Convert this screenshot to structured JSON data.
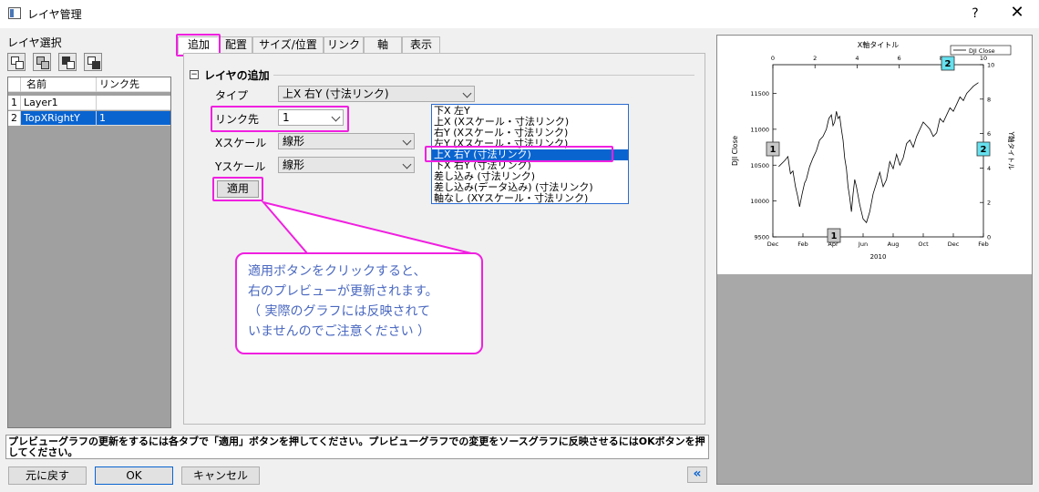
{
  "window": {
    "title": "レイヤ管理",
    "help": "?",
    "close": "✕"
  },
  "left_panel": {
    "label": "レイヤ選択",
    "columns": [
      "名前",
      "リンク先"
    ],
    "rows": [
      {
        "num": "1",
        "name": "Layer1",
        "link": ""
      },
      {
        "num": "2",
        "name": "TopXRightY",
        "link": "1"
      }
    ]
  },
  "tabs": [
    "追加",
    "配置",
    "サイズ/位置",
    "リンク",
    "軸",
    "表示"
  ],
  "section": {
    "toggle": "−",
    "title": "レイヤの追加"
  },
  "form": {
    "type_label": "タイプ",
    "type_value": "上X 右Y (寸法リンク)",
    "link_label": "リンク先",
    "link_value": "1",
    "xscale_label": "Xスケール",
    "xscale_value": "線形",
    "yscale_label": "Yスケール",
    "yscale_value": "線形",
    "apply": "適用"
  },
  "type_options": [
    "下X 左Y",
    "上X (Xスケール・寸法リンク)",
    "右Y (Xスケール・寸法リンク)",
    "左Y (Xスケール・寸法リンク)",
    "上X 右Y (寸法リンク)",
    "下X 右Y (寸法リンク)",
    "差し込み (寸法リンク)",
    "差し込み(データ込み) (寸法リンク)",
    "軸なし (XYスケール・寸法リンク)"
  ],
  "selected_option_index": 4,
  "callout": {
    "lines": [
      "適用ボタンをクリックすると、",
      "右のプレビューが更新されます。",
      "（ 実際のグラフには反映されて",
      "いませんのでご注意ください ）"
    ]
  },
  "status": "プレビューグラフの更新をするには各タブで「適用」ボタンを押してください。プレビューグラフでの変更をソースグラフに反映させるにはOKボタンを押してください。",
  "buttons": {
    "revert": "元に戻す",
    "ok": "OK",
    "cancel": "キャンセル",
    "collapse": "«"
  },
  "chart_data": {
    "type": "line",
    "top_xlabel": "X軸タイトル",
    "top_xticks": [
      "0",
      "2",
      "4",
      "6",
      "8",
      "10"
    ],
    "bottom_xticks": [
      "Dec",
      "Feb",
      "Apr",
      "Jun",
      "Aug",
      "Oct",
      "Dec",
      "Feb"
    ],
    "bottom_xlabel": "2010",
    "left_ylabel": "DJI Close",
    "left_yticks": [
      "9500",
      "10000",
      "10500",
      "11000",
      "11500"
    ],
    "left_ylim": [
      9500,
      11900
    ],
    "right_ylabel": "Y軸タイトル",
    "right_yticks": [
      "0",
      "2",
      "4",
      "6",
      "8",
      "10"
    ],
    "legend": "DJI Close",
    "layer_badges": [
      "1",
      "1",
      "2",
      "2"
    ],
    "series": [
      {
        "name": "DJI Close",
        "x": [
          0.35,
          0.7,
          0.9,
          1.05,
          1.2,
          1.35,
          1.5,
          1.6,
          1.75,
          1.9,
          2.0,
          2.2,
          2.4,
          2.6,
          2.8,
          3.0,
          3.2,
          3.35,
          3.5,
          3.6,
          3.7,
          3.8,
          3.9,
          4.0,
          4.1,
          4.2,
          4.3,
          4.4,
          4.5,
          4.6,
          4.7,
          4.8,
          4.9,
          5.0,
          5.2,
          5.4,
          5.6,
          5.8,
          6.0,
          6.2,
          6.4,
          6.6,
          6.8,
          7.0,
          7.2,
          7.4,
          7.6,
          7.8,
          8.0,
          8.2,
          8.4,
          8.6,
          8.8,
          9.0,
          9.2,
          9.4,
          9.6,
          9.8,
          10.0,
          10.2,
          10.4,
          10.6,
          10.8,
          11.0,
          11.2,
          11.4,
          11.6,
          11.8,
          12.0,
          12.3
        ],
        "y": [
          10480,
          10560,
          10620,
          10380,
          10420,
          10200,
          10050,
          9920,
          10100,
          10250,
          10300,
          10480,
          10600,
          10700,
          10850,
          10900,
          11000,
          11150,
          11200,
          11050,
          11100,
          11250,
          11150,
          11180,
          11000,
          10850,
          10600,
          10450,
          10200,
          10050,
          9850,
          10100,
          10300,
          10200,
          9950,
          9750,
          9700,
          9850,
          10100,
          10250,
          10400,
          10200,
          10300,
          10550,
          10450,
          10650,
          10500,
          10600,
          10800,
          10850,
          10750,
          10900,
          11000,
          11100,
          11050,
          11000,
          10900,
          10950,
          11150,
          11100,
          11200,
          11300,
          11250,
          11350,
          11450,
          11400,
          11500,
          11550,
          11600,
          11650
        ]
      }
    ]
  }
}
